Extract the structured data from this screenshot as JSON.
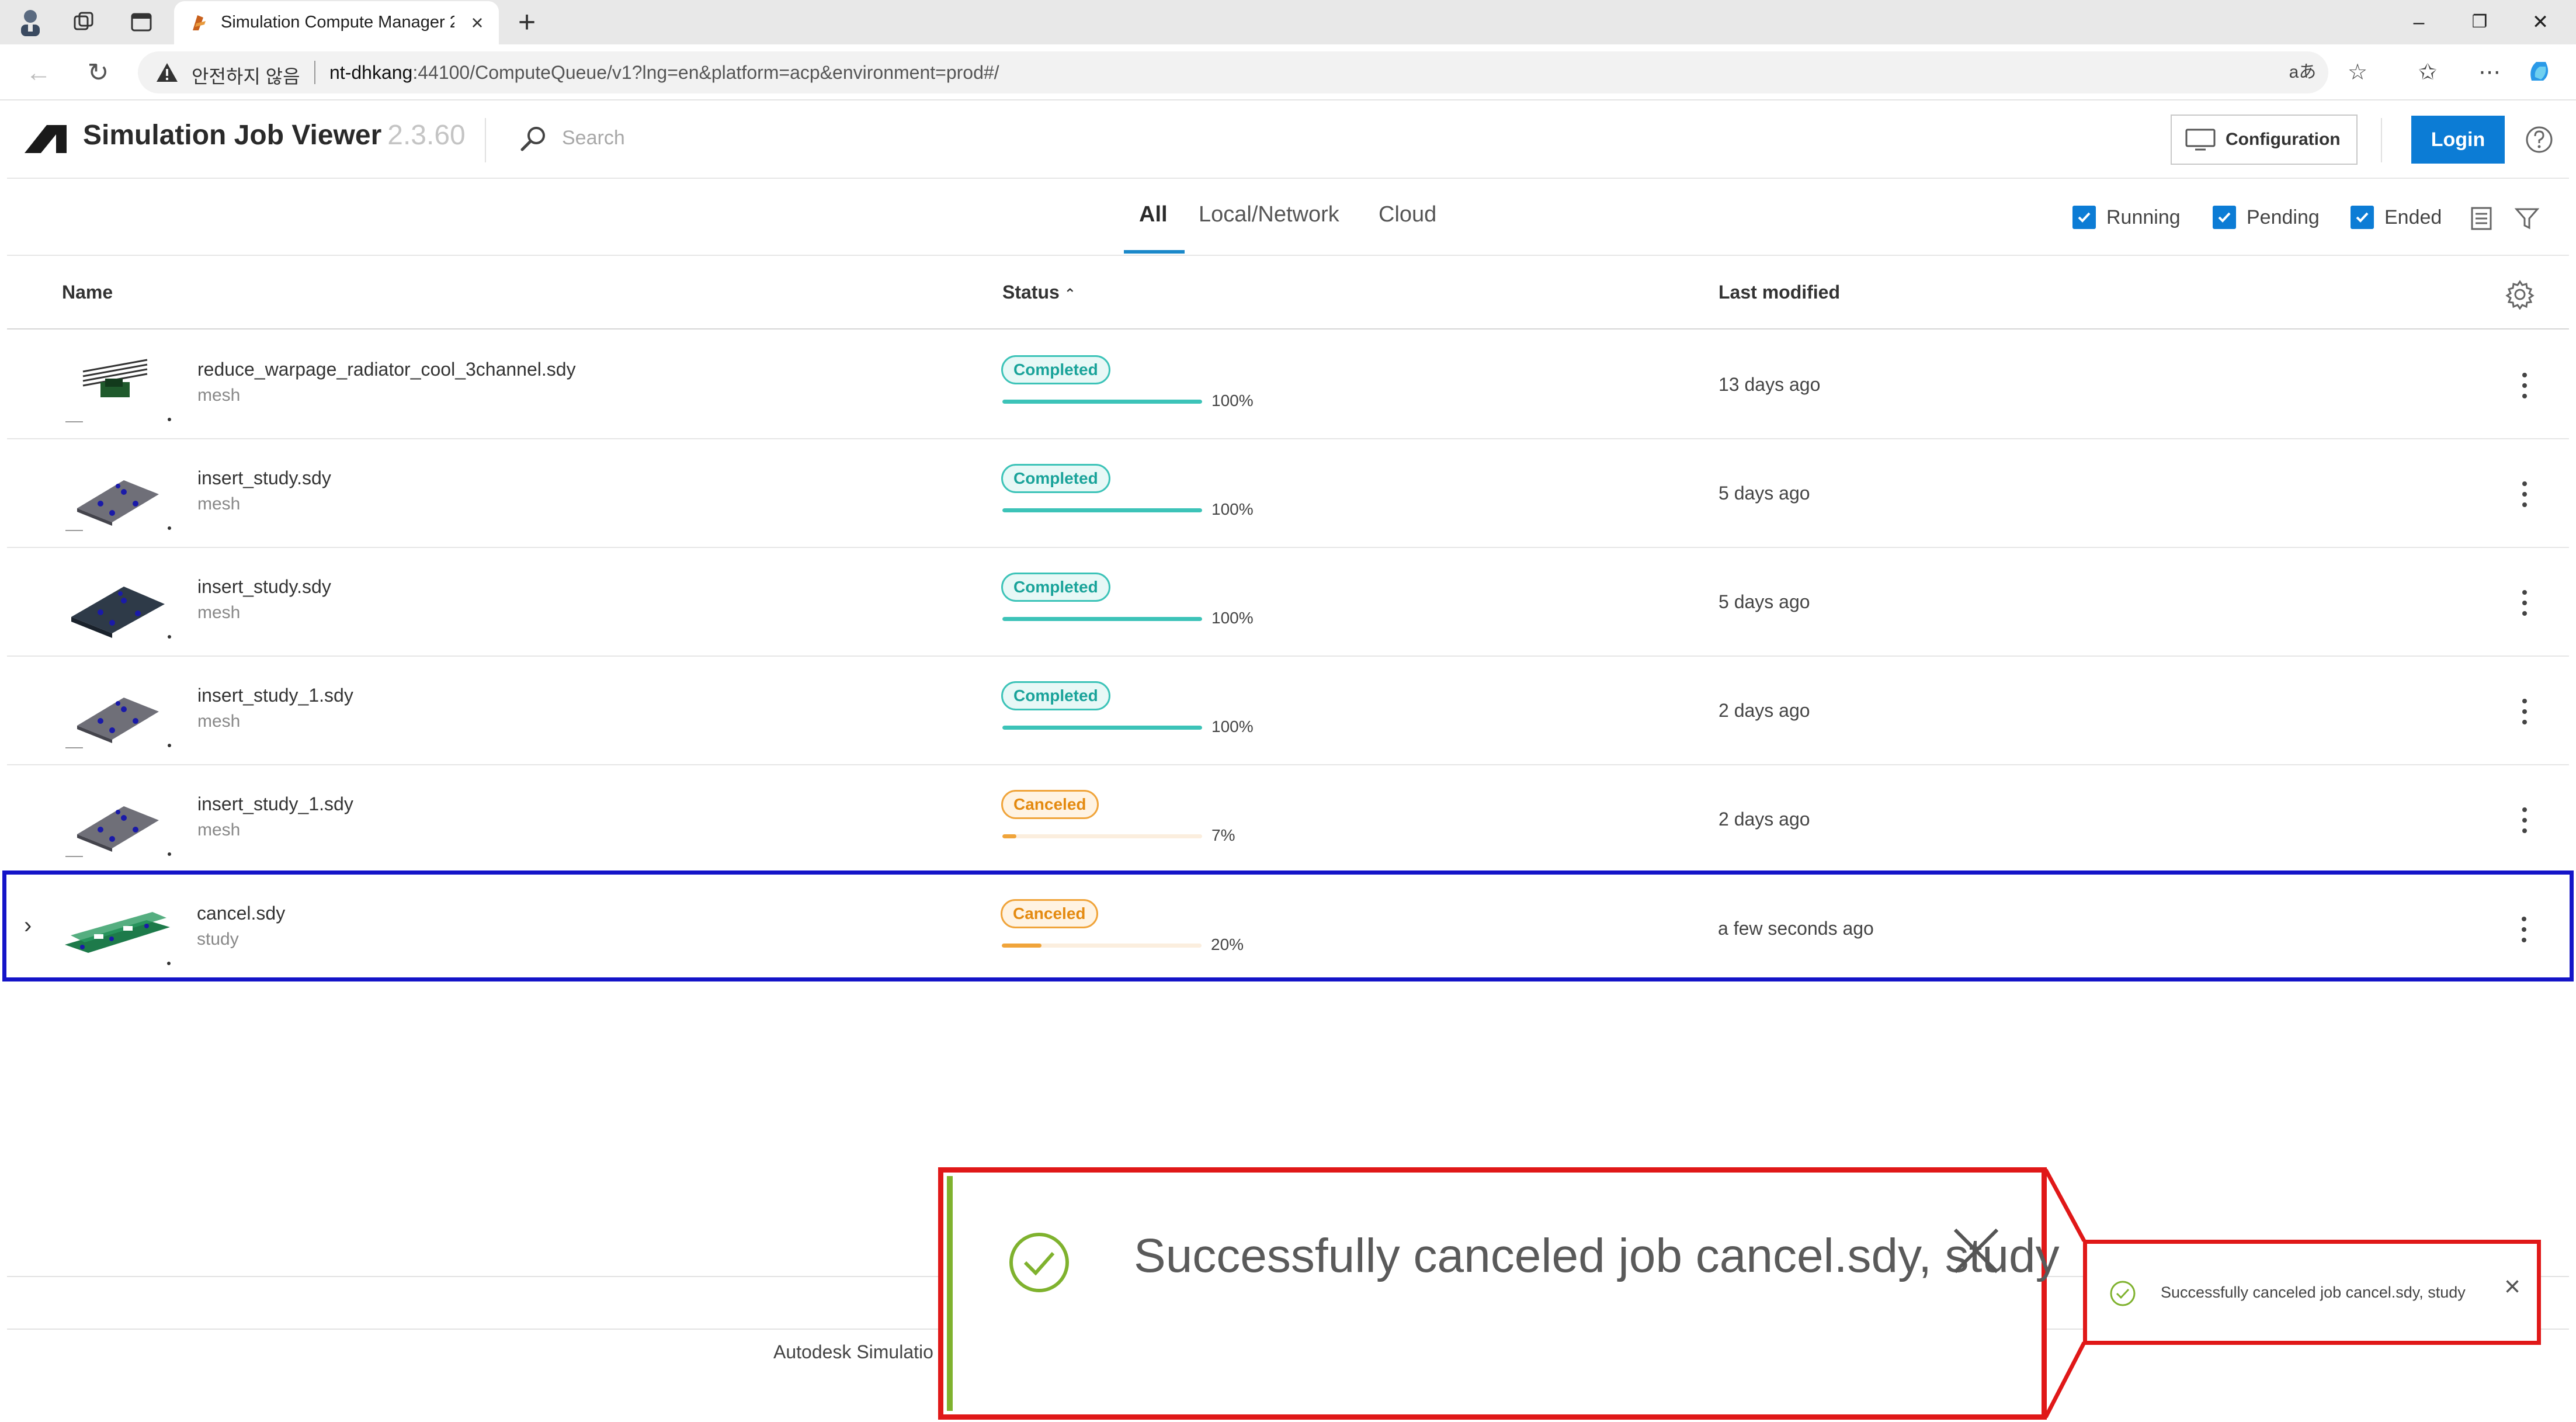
{
  "browser": {
    "tab_title": "Simulation Compute Manager 2.3",
    "security_warning": "안전하지 않음",
    "url_host": "nt-dhkang",
    "url_rest": ":44100/ComputeQueue/v1?lng=en&platform=acp&environment=prod#/"
  },
  "app": {
    "title": "Simulation Job Viewer",
    "version": "2.3.60",
    "search_placeholder": "Search",
    "config_label": "Configuration",
    "login_label": "Login",
    "accent_color": "#0c7cd5"
  },
  "filters": {
    "tabs": [
      "All",
      "Local/Network",
      "Cloud"
    ],
    "active_tab": "All",
    "checkboxes": [
      {
        "label": "Running",
        "checked": true
      },
      {
        "label": "Pending",
        "checked": true
      },
      {
        "label": "Ended",
        "checked": true
      }
    ]
  },
  "table": {
    "headers": {
      "name": "Name",
      "status": "Status",
      "modified": "Last modified"
    },
    "sort": "status-ascending",
    "rows": [
      {
        "name": "reduce_warpage_radiator_cool_3channel.sdy",
        "type": "mesh",
        "status": "Completed",
        "progress": 100,
        "progress_label": "100%",
        "modified": "13 days ago",
        "thumb": "radiator",
        "selected": false
      },
      {
        "name": "insert_study.sdy",
        "type": "mesh",
        "status": "Completed",
        "progress": 100,
        "progress_label": "100%",
        "modified": "5 days ago",
        "thumb": "plate-light",
        "selected": false
      },
      {
        "name": "insert_study.sdy",
        "type": "mesh",
        "status": "Completed",
        "progress": 100,
        "progress_label": "100%",
        "modified": "5 days ago",
        "thumb": "plate-dark",
        "selected": false
      },
      {
        "name": "insert_study_1.sdy",
        "type": "mesh",
        "status": "Completed",
        "progress": 100,
        "progress_label": "100%",
        "modified": "2 days ago",
        "thumb": "plate-light",
        "selected": false
      },
      {
        "name": "insert_study_1.sdy",
        "type": "mesh",
        "status": "Canceled",
        "progress": 7,
        "progress_label": "7%",
        "modified": "2 days ago",
        "thumb": "plate-light",
        "selected": false
      },
      {
        "name": "cancel.sdy",
        "type": "study",
        "status": "Canceled",
        "progress": 20,
        "progress_label": "20%",
        "modified": "a few seconds ago",
        "thumb": "mesh-green",
        "selected": true
      }
    ]
  },
  "footer": {
    "text": "Autodesk Simulatio"
  },
  "toast": {
    "message": "Successfully canceled job cancel.sdy, study"
  },
  "colors": {
    "completed": "#3cc3b8",
    "canceled": "#f0a43a",
    "highlight": "#1414c8",
    "callout": "#e01818"
  }
}
